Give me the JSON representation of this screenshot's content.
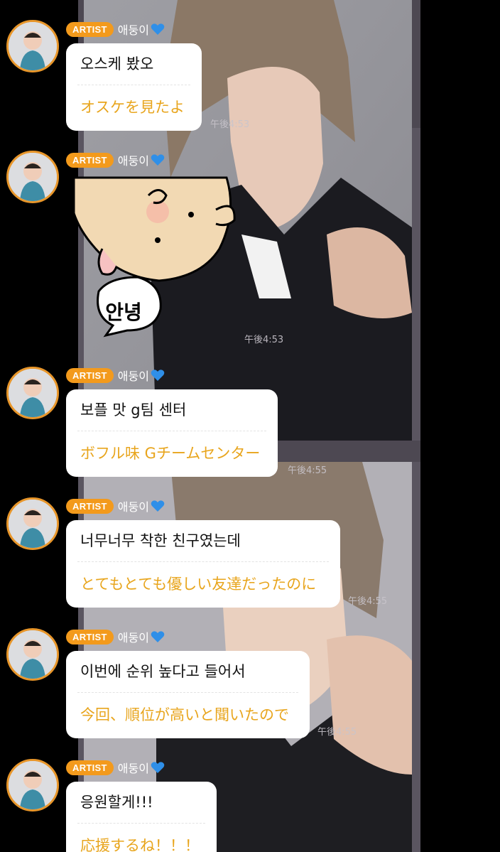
{
  "messages": [
    {
      "badge": "ARTIST",
      "name": "애둥이",
      "ko": "오스케 봤오",
      "ja": "オスケを見たよ",
      "time": "午後4:53"
    },
    {
      "badge": "ARTIST",
      "name": "애둥이",
      "sticker_text": "안녕",
      "time": "午後4:53"
    },
    {
      "badge": "ARTIST",
      "name": "애둥이",
      "ko": "보플 맛 g팀 센터",
      "ja": "ボフル味 Gチームセンター",
      "time": "午後4:55"
    },
    {
      "badge": "ARTIST",
      "name": "애둥이",
      "ko": "너무너무 착한 친구였는데",
      "ja": "とてもとても優しい友達だったのに",
      "time": "午後4:55"
    },
    {
      "badge": "ARTIST",
      "name": "애둥이",
      "ko": "이번에 순위 높다고 들어서",
      "ja": "今回、順位が高いと聞いたので",
      "time": "午後4:55"
    },
    {
      "badge": "ARTIST",
      "name": "애둥이",
      "ko": "응원할게!!!",
      "ja": "応援するね！！！",
      "time": ""
    }
  ],
  "icons": {
    "heart": "blue-heart-icon",
    "avatar": "child-photo-avatar"
  },
  "colors": {
    "badge": "#f39a1c",
    "translation": "#e8a51d",
    "avatar_ring": "#e8962a",
    "heart": "#2f8fe8"
  }
}
